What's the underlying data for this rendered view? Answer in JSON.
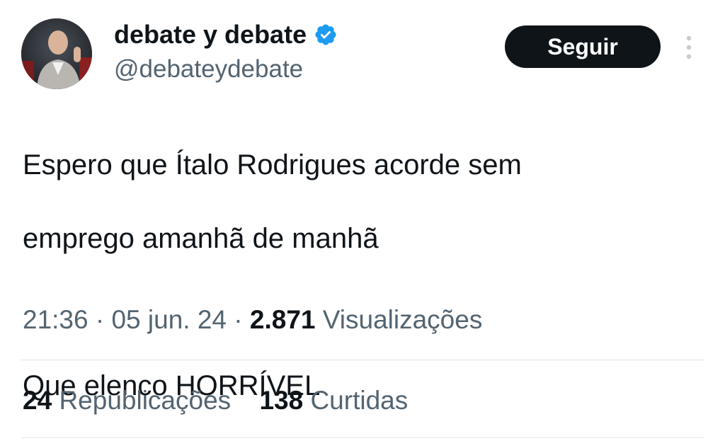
{
  "author": {
    "display_name": "debate y debate",
    "handle": "@debateydebate",
    "verified": true,
    "avatar_icon": "avatar-image"
  },
  "actions": {
    "follow_label": "Seguir",
    "more_icon": "more-vertical-icon"
  },
  "tweet": {
    "lines": [
      "Espero que Ítalo Rodrigues acorde sem",
      "emprego amanhã de manhã",
      "",
      "Que elenco HORRÍVEL"
    ]
  },
  "meta": {
    "time": "21:36",
    "separator": "·",
    "date": "05 jun. 24",
    "views_count": "2.871",
    "views_label": "Visualizações"
  },
  "stats": {
    "reposts_count": "24",
    "reposts_label": "Republicações",
    "likes_count": "138",
    "likes_label": "Curtidas"
  },
  "colors": {
    "text_primary": "#0f1419",
    "text_secondary": "#536471",
    "verified_blue": "#1d9bf0",
    "follow_button_bg": "#0f1419",
    "divider": "#dfe3e6"
  }
}
